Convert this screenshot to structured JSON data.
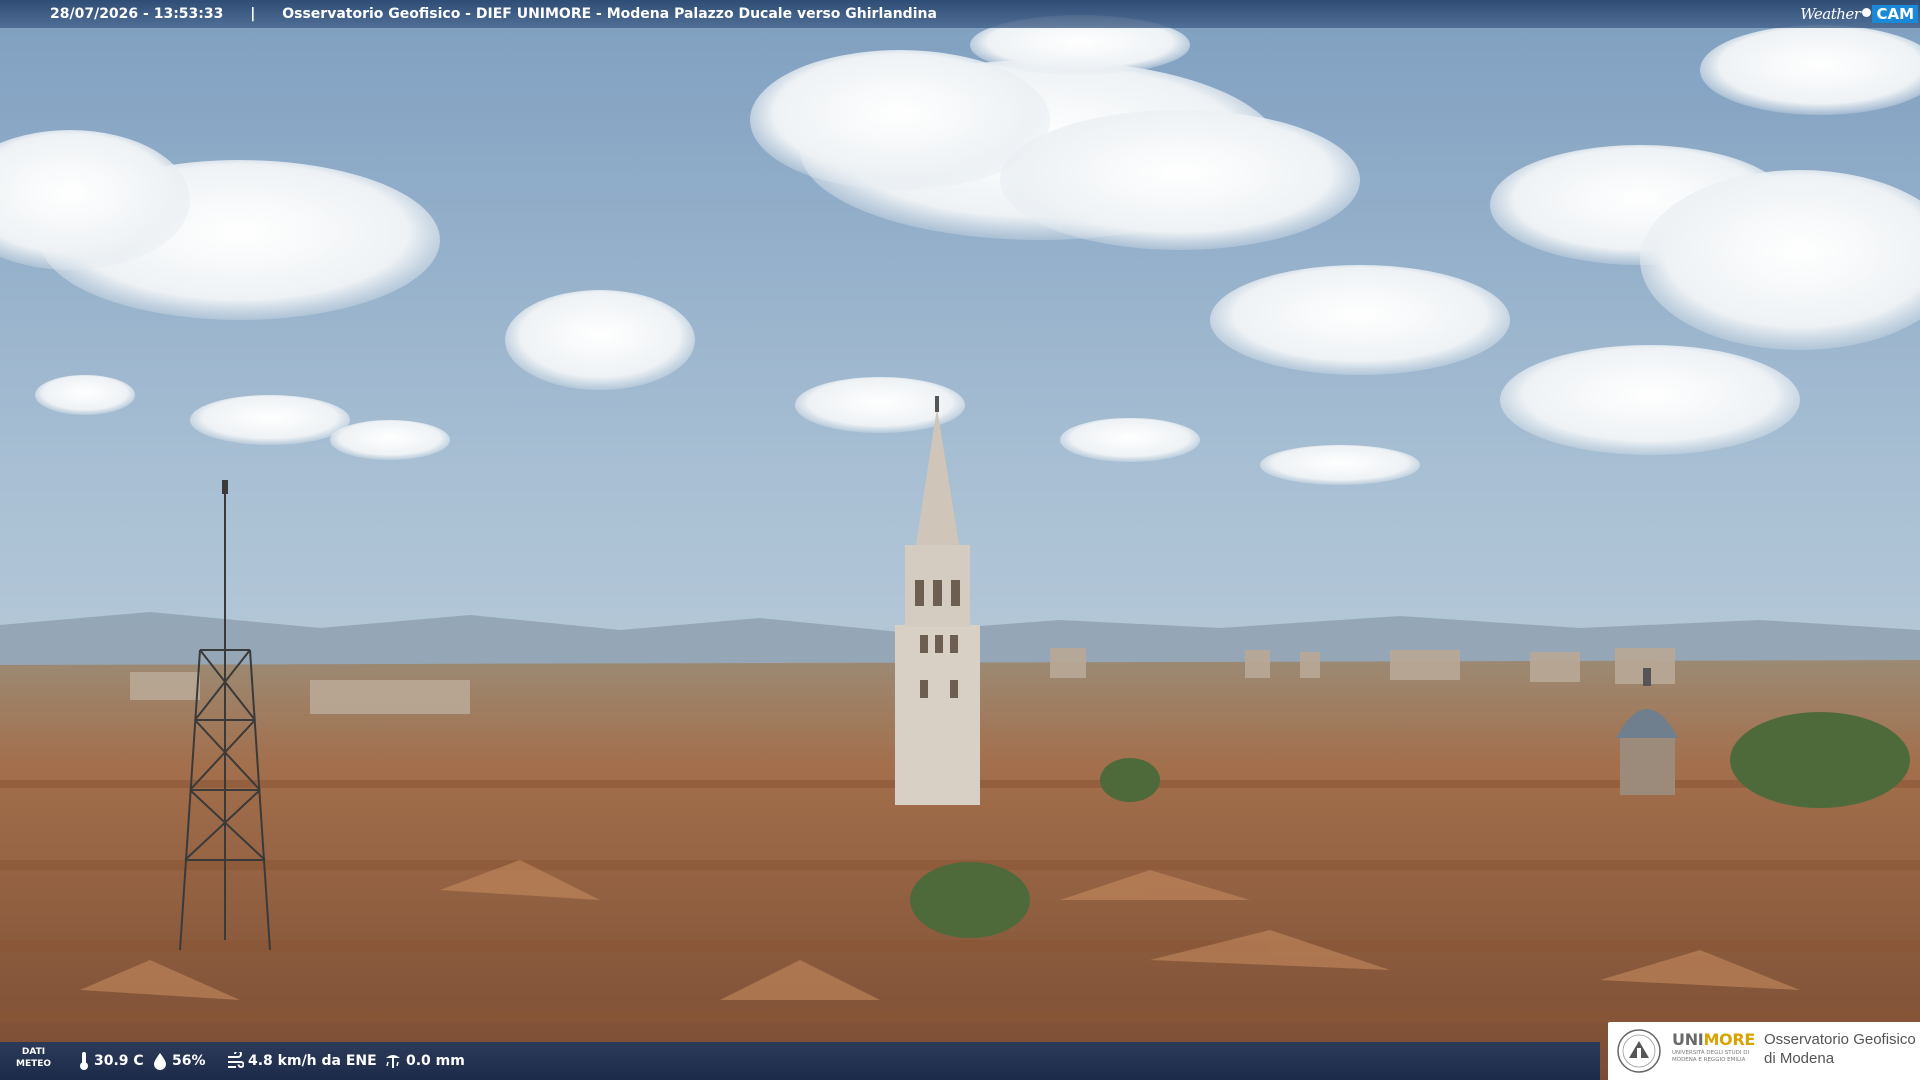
{
  "overlay": {
    "timestamp": "28/07/2026 - 13:53:33",
    "separator": "|",
    "caption": "Osservatorio Geofisico - DIEF UNIMORE - Modena Palazzo Ducale verso Ghirlandina",
    "brand": {
      "weather": "Weather",
      "cam": "CAM"
    }
  },
  "meteo": {
    "label_line1": "DATI",
    "label_line2": "METEO",
    "temperature": "30.9 C",
    "humidity": "56%",
    "wind": "4.8 km/h da ENE",
    "rain": "0.0 mm",
    "icons": [
      "thermometer-icon",
      "humidity-drop-icon",
      "wind-icon",
      "rain-gauge-icon"
    ]
  },
  "logo": {
    "uni": "UNI",
    "more": "MORE",
    "subtitle": "UNIVERSITÀ DEGLI STUDI DI MODENA E REGGIO EMILIA",
    "observatory_line1": "Osservatorio Geofisico",
    "observatory_line2": "di Modena"
  },
  "colors": {
    "overlay_bar": "#2c4a76",
    "cam_accent": "#1a8ad8",
    "unimore_gold": "#d8a300",
    "sky": "#a9c0d4",
    "roofs": "#a8714b"
  }
}
